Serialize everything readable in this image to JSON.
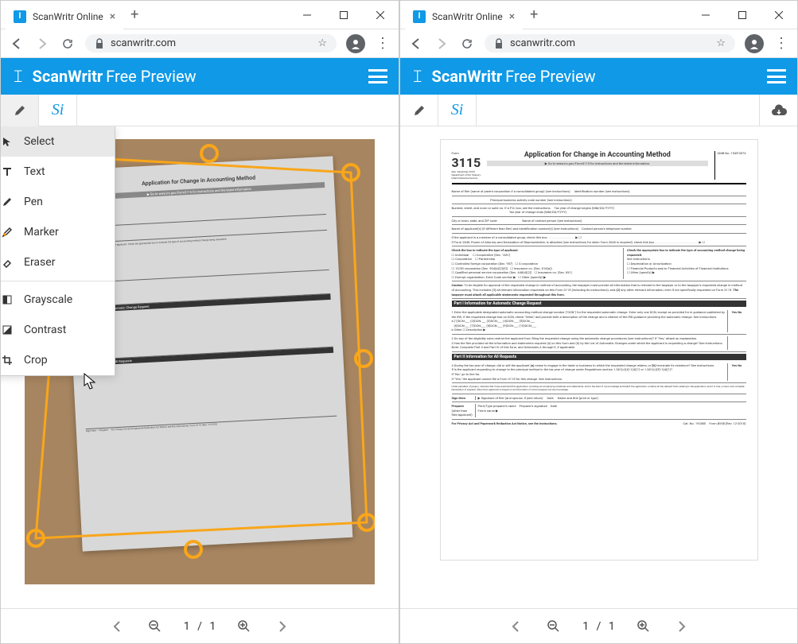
{
  "browser": {
    "tab_title": "ScanWritr Online",
    "url": "scanwritr.com"
  },
  "app": {
    "brand": "ScanWritr",
    "subtitle": "Free Preview"
  },
  "tools_menu": {
    "items": [
      {
        "icon": "cursor",
        "label": "Select"
      },
      {
        "icon": "text",
        "label": "Text"
      },
      {
        "icon": "pen",
        "label": "Pen"
      },
      {
        "icon": "marker",
        "label": "Marker"
      },
      {
        "icon": "eraser",
        "label": "Eraser"
      },
      {
        "icon": "grayscale",
        "label": "Grayscale"
      },
      {
        "icon": "contrast",
        "label": "Contrast"
      },
      {
        "icon": "crop",
        "label": "Crop"
      }
    ]
  },
  "document": {
    "form_number": "3115",
    "form_title": "Application for Change in Accounting Method",
    "instruction": "▶ Go to www.irs.gov/Form3115 for instructions and the latest information.",
    "omb": "OMB No. 1545-0073",
    "part1_title": "Part I   Information for Automatic Change Request",
    "part2_title": "Part II   Information for All Requests",
    "applicant_heading": "Check the box to indicate the type of applicant.",
    "change_heading": "Check the appropriate box to indicate the type of accounting method change being requested."
  },
  "pager": {
    "current": "1",
    "sep": "/",
    "total": "1"
  }
}
